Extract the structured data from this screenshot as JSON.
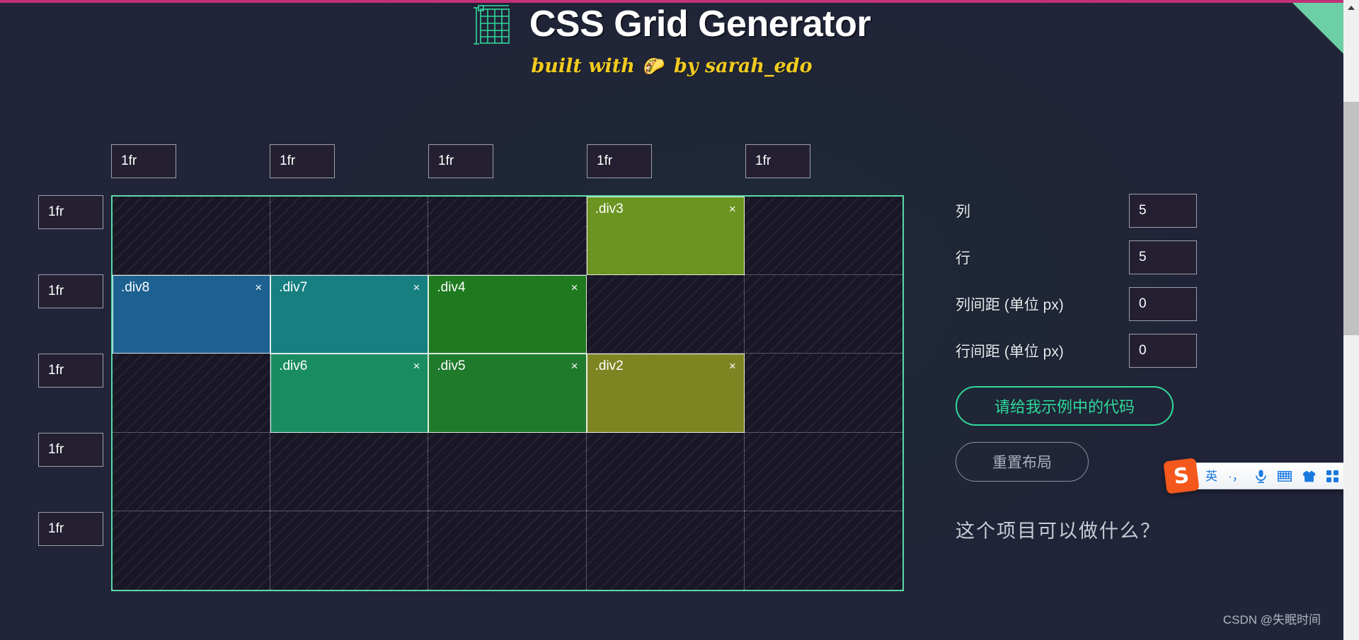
{
  "header": {
    "title": "CSS Grid Generator",
    "logo_icon": "grid-logo-icon",
    "subtitle_prefix": "built with",
    "subtitle_emoji": "🌮",
    "subtitle_suffix": "by sarah_edo"
  },
  "theme": {
    "accent_green": "#5bdba7",
    "accent_button_green": "#2fd99a",
    "top_border_pink": "#c2307a",
    "ribbon_green": "#6ccfa5",
    "subtitle_yellow": "#f2cb1f",
    "page_bg": "#1f2636",
    "grid_bg": "#191626"
  },
  "grid": {
    "columns": 5,
    "rows": 5,
    "column_tracks": [
      "1fr",
      "1fr",
      "1fr",
      "1fr",
      "1fr"
    ],
    "row_tracks": [
      "1fr",
      "1fr",
      "1fr",
      "1fr",
      "1fr"
    ],
    "close_glyph": "×",
    "items": [
      {
        "label": ".div3",
        "col_start": 4,
        "col_span": 1,
        "row_start": 1,
        "row_span": 1,
        "color": "#6b9420"
      },
      {
        "label": ".div8",
        "col_start": 1,
        "col_span": 1,
        "row_start": 2,
        "row_span": 1,
        "color": "#1d6191"
      },
      {
        "label": ".div7",
        "col_start": 2,
        "col_span": 1,
        "row_start": 2,
        "row_span": 1,
        "color": "#177f80"
      },
      {
        "label": ".div4",
        "col_start": 3,
        "col_span": 1,
        "row_start": 2,
        "row_span": 1,
        "color": "#1f7a1f"
      },
      {
        "label": ".div6",
        "col_start": 2,
        "col_span": 1,
        "row_start": 3,
        "row_span": 1,
        "color": "#1a8c62"
      },
      {
        "label": ".div5",
        "col_start": 3,
        "col_span": 1,
        "row_start": 3,
        "row_span": 1,
        "color": "#1f7a2c"
      },
      {
        "label": ".div2",
        "col_start": 4,
        "col_span": 1,
        "row_start": 3,
        "row_span": 1,
        "color": "#7d8523"
      }
    ]
  },
  "settings": {
    "columns_label": "列",
    "columns_value": "5",
    "rows_label": "行",
    "rows_value": "5",
    "column_gap_label": "列间距 (单位 px)",
    "column_gap_value": "0",
    "row_gap_label": "行间距 (单位 px)",
    "row_gap_value": "0",
    "primary_button": "请给我示例中的代码",
    "secondary_button": "重置布局",
    "footer_question": "这个项目可以做什么？"
  },
  "ime": {
    "logo_text": "S",
    "mode": "英",
    "punctuation": "·，",
    "mic_icon": "microphone-icon",
    "keyboard_icon": "keyboard-icon",
    "skin_icon": "shirt-icon",
    "apps_icon": "apps-grid-icon"
  },
  "watermark": "CSDN @失眠时间"
}
